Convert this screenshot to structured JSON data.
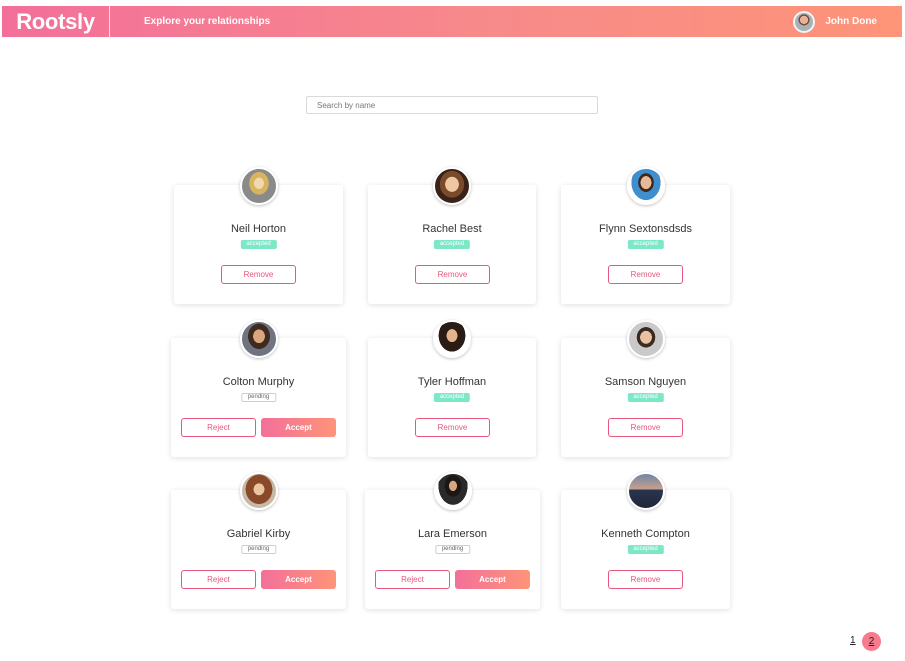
{
  "header": {
    "logo": "Rootsly",
    "tagline": "Explore your relationships",
    "user_name": "John Done"
  },
  "search": {
    "placeholder": "Search by name",
    "value": ""
  },
  "cards": [
    {
      "name": "Neil Horton",
      "status": "accepted",
      "actions": [
        "Remove"
      ]
    },
    {
      "name": "Rachel Best",
      "status": "accepted",
      "actions": [
        "Remove"
      ]
    },
    {
      "name": "Flynn Sextonsdsds",
      "status": "accepted",
      "actions": [
        "Remove"
      ]
    },
    {
      "name": "Colton Murphy",
      "status": "pending",
      "actions": [
        "Reject",
        "Accept"
      ]
    },
    {
      "name": "Tyler Hoffman",
      "status": "accepted",
      "actions": [
        "Remove"
      ]
    },
    {
      "name": "Samson Nguyen",
      "status": "accepted",
      "actions": [
        "Remove"
      ]
    },
    {
      "name": "Gabriel Kirby",
      "status": "pending",
      "actions": [
        "Reject",
        "Accept"
      ]
    },
    {
      "name": "Lara Emerson",
      "status": "pending",
      "actions": [
        "Reject",
        "Accept"
      ]
    },
    {
      "name": "Kenneth Compton",
      "status": "accepted",
      "actions": [
        "Remove"
      ]
    }
  ],
  "pagination": {
    "pages": [
      "1",
      "2"
    ],
    "current": "2"
  },
  "colors": {
    "accent_start": "#f36f9a",
    "accent_end": "#fe9478",
    "accepted": "#7ce8c8"
  }
}
